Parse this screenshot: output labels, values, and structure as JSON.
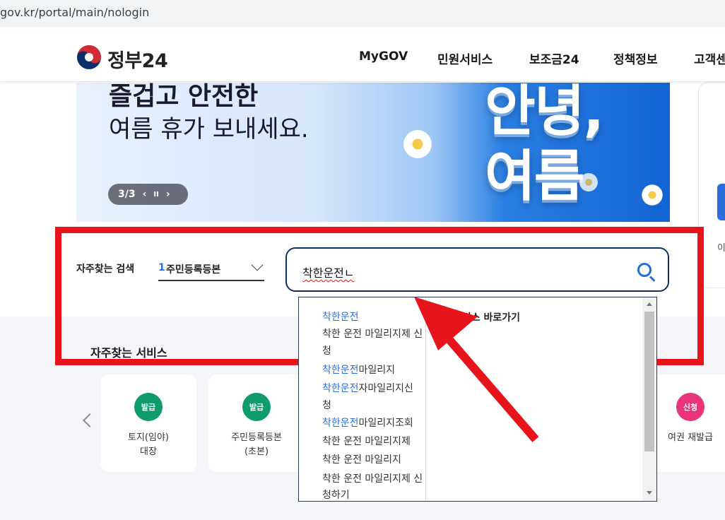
{
  "browser": {
    "url": "gov.kr/portal/main/nologin"
  },
  "header": {
    "logo_text": "정부24",
    "nav": [
      "MyGOV",
      "민원서비스",
      "보조금24",
      "정책정보",
      "고객센"
    ]
  },
  "banner": {
    "line1": "즐겁고 안전한",
    "line2": "여름 휴가 보내세요.",
    "big1": "안녕,",
    "big2": "여름",
    "pager": {
      "count": "3/3",
      "prev": "‹",
      "pause": "II",
      "next": "›"
    }
  },
  "side": {
    "text": "이"
  },
  "search": {
    "label": "자주찾는 검색",
    "select_num": "1",
    "select_value": "주민등록등본",
    "query": "착한운전ㄴ",
    "search_icon": "search-icon"
  },
  "autocomplete": {
    "right_title": "서비스 바로가기",
    "items": [
      {
        "hl": "착한운전",
        "rest": ""
      },
      {
        "hl": "",
        "rest": "착한 운전 마일리지제 신"
      },
      {
        "hl": "",
        "rest": "청"
      },
      {
        "hl": "착한운전",
        "rest": "마일리지"
      },
      {
        "hl": "착한운전",
        "rest": "자마일리지신"
      },
      {
        "hl": "",
        "rest": "청"
      },
      {
        "hl": "착한운전",
        "rest": "마일리지조회"
      },
      {
        "hl": "",
        "rest": "착한 운전 마일리지제"
      },
      {
        "hl": "",
        "rest": "착한 운전 마일리지"
      },
      {
        "hl": "",
        "rest": "착한 운전 마일리지제 신"
      },
      {
        "hl": "",
        "rest": "청하기"
      }
    ]
  },
  "services": {
    "title": "자주찾는 서비스",
    "cards": [
      {
        "badge": "발급",
        "badge_color": "#0f9b6c",
        "name1": "토지(임야)",
        "name2": "대장"
      },
      {
        "badge": "발급",
        "badge_color": "#0f9b6c",
        "name1": "주민등록등본",
        "name2": "(초본)"
      },
      {
        "badge": "신청",
        "badge_color": "#e8357a",
        "name1": "여권 재발급",
        "name2": ""
      }
    ]
  },
  "colors": {
    "highlight_red": "#e8141b",
    "accent_blue": "#2a6fdb",
    "navy": "#0b2f5e"
  }
}
